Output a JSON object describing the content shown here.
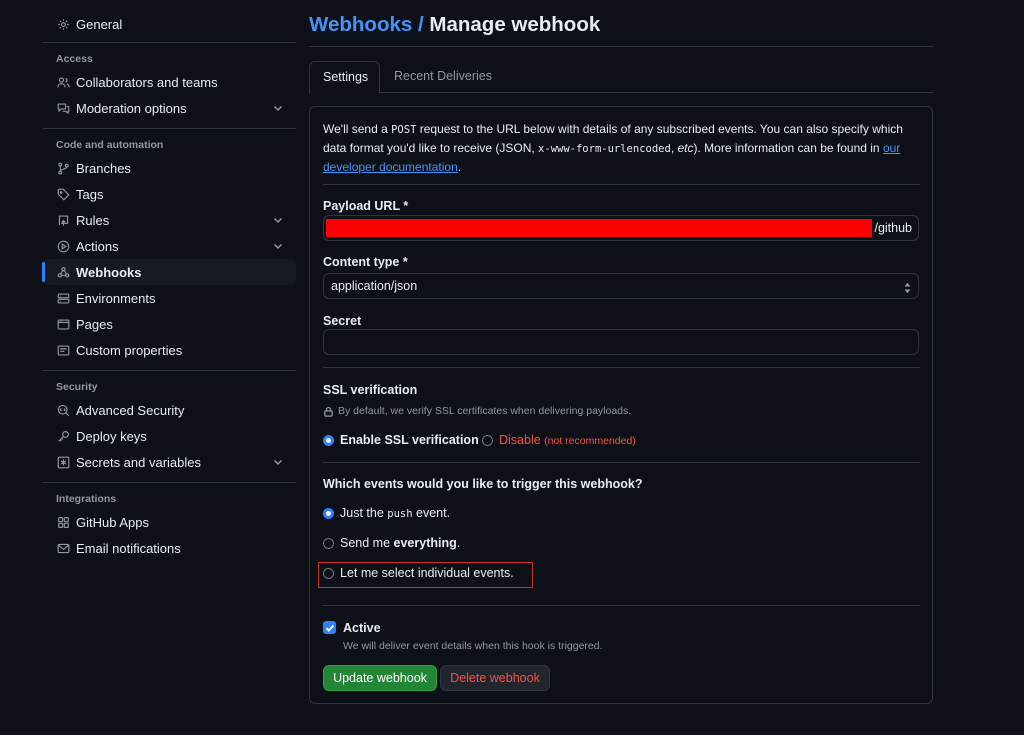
{
  "sidebar": {
    "general": "General",
    "sections": [
      {
        "heading": "Access",
        "items": [
          {
            "label": "Collaborators and teams",
            "icon": "people-icon"
          },
          {
            "label": "Moderation options",
            "icon": "comment-discussion-icon",
            "expandable": true
          }
        ]
      },
      {
        "heading": "Code and automation",
        "items": [
          {
            "label": "Branches",
            "icon": "git-branch-icon"
          },
          {
            "label": "Tags",
            "icon": "tag-icon"
          },
          {
            "label": "Rules",
            "icon": "repo-push-icon",
            "expandable": true
          },
          {
            "label": "Actions",
            "icon": "play-icon",
            "expandable": true
          },
          {
            "label": "Webhooks",
            "icon": "webhook-icon",
            "active": true
          },
          {
            "label": "Environments",
            "icon": "server-icon"
          },
          {
            "label": "Pages",
            "icon": "browser-icon"
          },
          {
            "label": "Custom properties",
            "icon": "note-icon"
          }
        ]
      },
      {
        "heading": "Security",
        "items": [
          {
            "label": "Advanced Security",
            "icon": "codescan-icon"
          },
          {
            "label": "Deploy keys",
            "icon": "key-icon"
          },
          {
            "label": "Secrets and variables",
            "icon": "key-asterisk-icon",
            "expandable": true
          }
        ]
      },
      {
        "heading": "Integrations",
        "items": [
          {
            "label": "GitHub Apps",
            "icon": "apps-icon"
          },
          {
            "label": "Email notifications",
            "icon": "mail-icon"
          }
        ]
      }
    ]
  },
  "header": {
    "breadcrumb": "Webhooks",
    "separator": "/",
    "title": "Manage webhook"
  },
  "tabs": [
    {
      "label": "Settings",
      "selected": true
    },
    {
      "label": "Recent Deliveries",
      "selected": false
    }
  ],
  "intro": {
    "part1": "We'll send a ",
    "post": "POST",
    "part2": " request to the URL below with details of any subscribed events. You can also specify which data format you'd like to receive (JSON, ",
    "format": "x-www-form-urlencoded",
    "part3": ", ",
    "etc": "etc",
    "part4": "). More information can be found in ",
    "link": "our developer documentation",
    "part5": "."
  },
  "form": {
    "payload_label": "Payload URL *",
    "payload_suffix": "/github",
    "content_type_label": "Content type *",
    "content_type_value": "application/json",
    "secret_label": "Secret",
    "secret_value": "",
    "ssl_label": "SSL verification",
    "ssl_help": "By default, we verify SSL certificates when delivering payloads.",
    "ssl_enable": "Enable SSL verification",
    "ssl_disable": "Disable",
    "ssl_disable_note": "(not recommended)",
    "events_label": "Which events would you like to trigger this webhook?",
    "event_push_pre": "Just the ",
    "event_push_code": "push",
    "event_push_post": " event.",
    "event_all_pre": "Send me ",
    "event_all_bold": "everything",
    "event_all_post": ".",
    "event_select": "Let me select individual events.",
    "active_label": "Active",
    "active_help": "We will deliver event details when this hook is triggered.",
    "active_checked": true,
    "update_button": "Update webhook",
    "delete_button": "Delete webhook"
  },
  "colors": {
    "accent": "#2f81f7",
    "link": "#4493f8",
    "primary_button": "#238636",
    "danger": "#f85149",
    "highlight_box": "#c9302c",
    "redaction": "#ff0000"
  }
}
